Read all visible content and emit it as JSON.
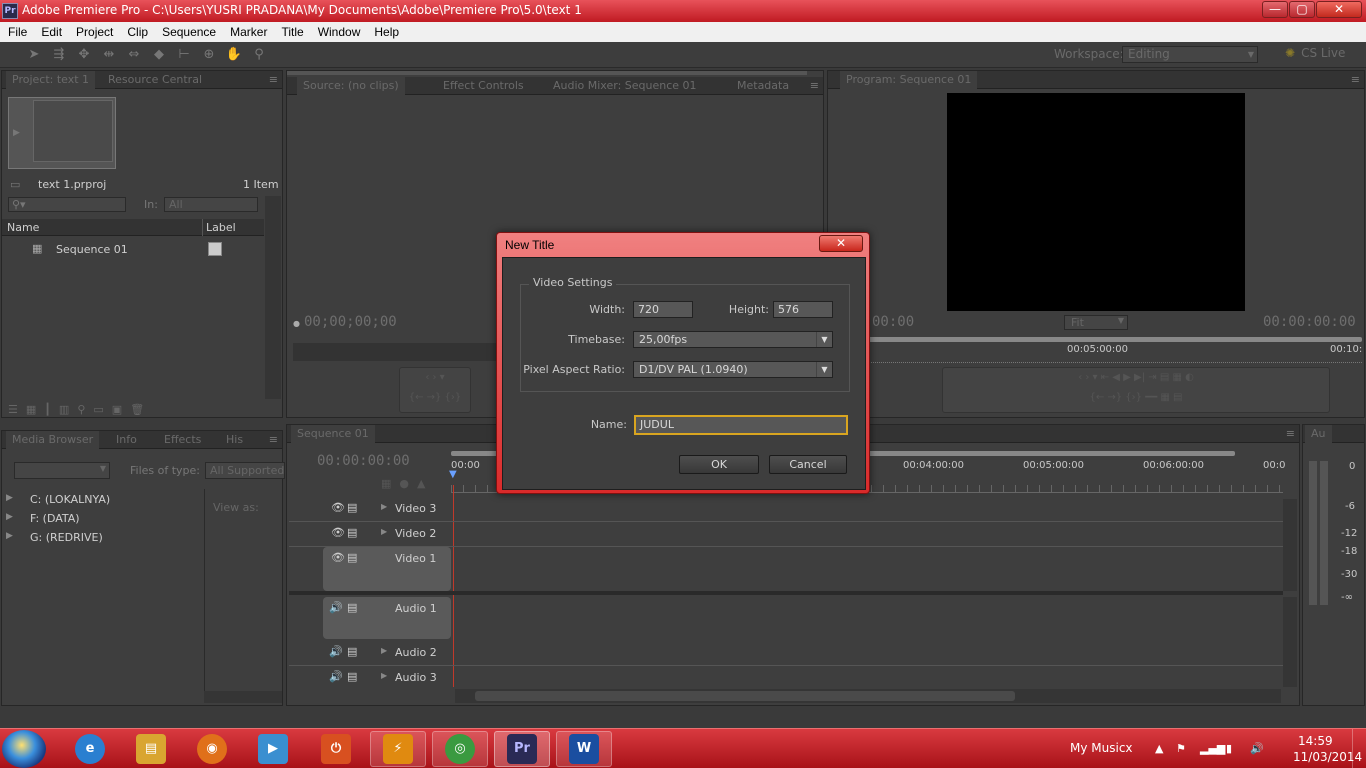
{
  "window": {
    "title": "Adobe Premiere Pro - C:\\Users\\YUSRI PRADANA\\My Documents\\Adobe\\Premiere Pro\\5.0\\text 1",
    "app_icon": "Pr",
    "minimize_glyph": "—",
    "maximize_glyph": "▢",
    "close_glyph": "✕"
  },
  "menu": [
    "File",
    "Edit",
    "Project",
    "Clip",
    "Sequence",
    "Marker",
    "Title",
    "Window",
    "Help"
  ],
  "toolbar": {
    "tools": [
      "selection-tool",
      "track-select-tool",
      "ripple-edit-tool",
      "rolling-edit-tool",
      "rate-stretch-tool",
      "razor-tool",
      "slip-tool",
      "slide-tool",
      "hand-tool",
      "zoom-tool"
    ],
    "workspace_label": "Workspace:",
    "workspace_value": "Editing",
    "cs_live": "CS Live"
  },
  "project_panel": {
    "tabs": [
      "Project: text 1",
      "Resource Central"
    ],
    "project_file": "text 1.prproj",
    "item_count": "1 Item",
    "in_label": "In:",
    "in_value": "All",
    "col_name": "Name",
    "col_label": "Label",
    "items": [
      "Sequence 01"
    ]
  },
  "source_panel": {
    "tabs": [
      "Source: (no clips)",
      "Effect Controls",
      "Audio Mixer: Sequence 01",
      "Metadata"
    ],
    "timecode": "00;00;00;00"
  },
  "program_panel": {
    "tab": "Program: Sequence 01",
    "timecode_left": "00:00",
    "timecode_right": "00:00:00:00",
    "zoom": "Fit",
    "ruler_mark_1": "00:05:00:00",
    "ruler_mark_2": "00:10:"
  },
  "media_panel": {
    "tabs": [
      "Media Browser",
      "Info",
      "Effects",
      "His"
    ],
    "files_of_type_label": "Files of type:",
    "files_of_type_value": "All Supported",
    "view_as_label": "View as:",
    "drives": [
      "C: (LOKALNYA)",
      "F: (DATA)",
      "G: (REDRIVE)"
    ]
  },
  "timeline": {
    "tab": "Sequence 01",
    "timecode": "00:00:00:00",
    "ruler": [
      "00:00",
      "00:04:00:00",
      "00:05:00:00",
      "00:06:00:00",
      "00:0"
    ],
    "video_tracks": [
      "Video 3",
      "Video 2",
      "Video 1"
    ],
    "audio_tracks": [
      "Audio 1",
      "Audio 2",
      "Audio 3"
    ]
  },
  "audio_meter": {
    "tab": "Au",
    "scale": [
      "0",
      "-6",
      "-12",
      "-18",
      "-30",
      "-∞"
    ]
  },
  "dialog": {
    "title": "New Title",
    "group": "Video Settings",
    "width_label": "Width:",
    "width_value": "720",
    "height_label": "Height:",
    "height_value": "576",
    "timebase_label": "Timebase:",
    "timebase_value": "25,00fps",
    "par_label": "Pixel Aspect Ratio:",
    "par_value": "D1/DV PAL (1.0940)",
    "name_label": "Name:",
    "name_value": "JUDUL",
    "ok": "OK",
    "cancel": "Cancel"
  },
  "taskbar": {
    "apps": [
      {
        "name": "internet-explorer",
        "glyph": "e",
        "color": "#2a7fd0"
      },
      {
        "name": "file-explorer",
        "glyph": "▤",
        "color": "#d9a530"
      },
      {
        "name": "firefox",
        "glyph": "◉",
        "color": "#e0701a"
      },
      {
        "name": "media-player",
        "glyph": "▶",
        "color": "#3a8fd0"
      },
      {
        "name": "power-app",
        "glyph": "⏻",
        "color": "#d85020"
      },
      {
        "name": "winamp",
        "glyph": "⚡",
        "color": "#e08a10"
      },
      {
        "name": "chrome",
        "glyph": "◎",
        "color": "#3a9a40"
      },
      {
        "name": "premiere-pro",
        "glyph": "Pr",
        "color": "#2a2a55"
      },
      {
        "name": "word",
        "glyph": "W",
        "color": "#1a4ea0"
      }
    ],
    "tray_label": "My Musicx",
    "time": "14:59",
    "date": "11/03/2014"
  }
}
